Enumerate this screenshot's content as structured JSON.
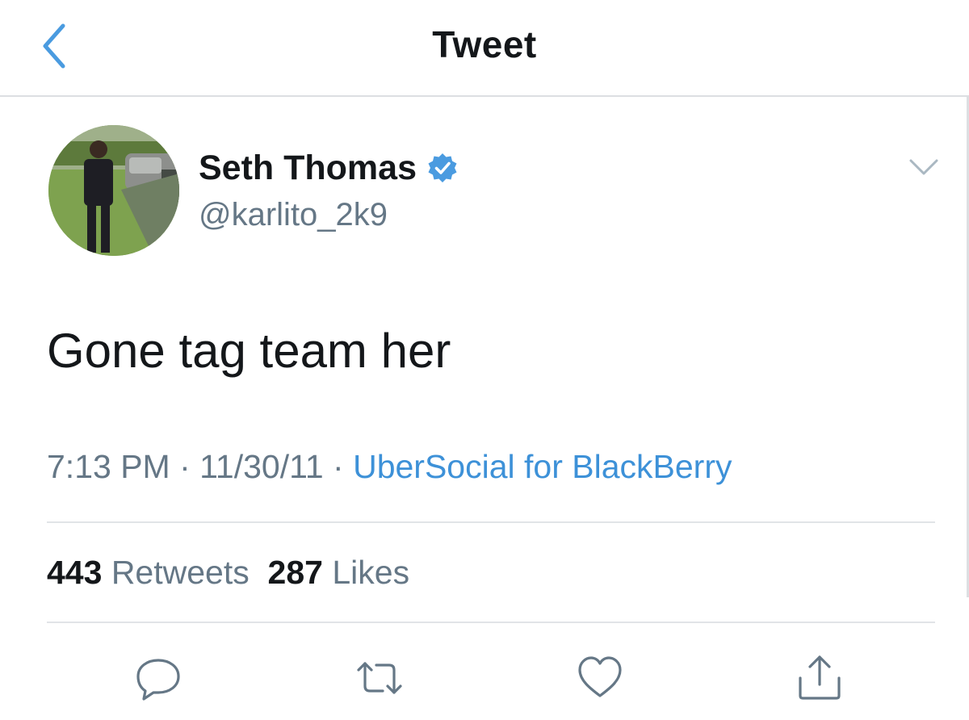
{
  "header": {
    "title": "Tweet",
    "back_icon": "chevron-left-icon",
    "accent_color": "#4a9be0"
  },
  "tweet": {
    "author": {
      "display_name": "Seth Thomas",
      "handle": "@karlito_2k9",
      "verified": true,
      "verified_badge_color": "#4a9be0"
    },
    "text": "Gone tag team her",
    "timestamp": {
      "time": "7:13 PM",
      "separator_1": " · ",
      "date": "11/30/11",
      "separator_2": " · ",
      "source": "UberSocial for BlackBerry"
    },
    "stats": {
      "retweets_count": "443",
      "retweets_label": "Retweets",
      "likes_count": "287",
      "likes_label": "Likes"
    }
  },
  "actions": [
    {
      "icon": "reply-icon"
    },
    {
      "icon": "retweet-icon"
    },
    {
      "icon": "like-icon"
    },
    {
      "icon": "share-icon"
    }
  ]
}
